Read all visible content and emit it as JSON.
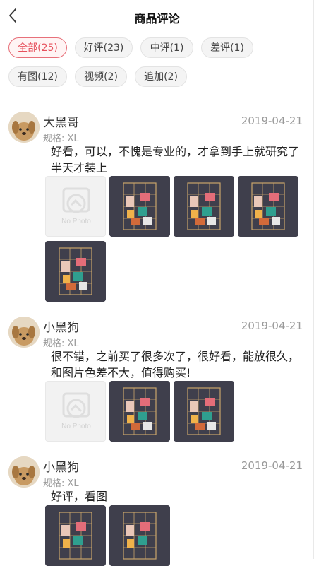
{
  "header": {
    "title": "商品评论"
  },
  "filters": [
    {
      "label": "全部(25)",
      "active": true
    },
    {
      "label": "好评(23)",
      "active": false
    },
    {
      "label": "中评(1)",
      "active": false
    },
    {
      "label": "差评(1)",
      "active": false
    },
    {
      "label": "有图(12)",
      "active": false
    },
    {
      "label": "视频(2)",
      "active": false
    },
    {
      "label": "追加(2)",
      "active": false
    }
  ],
  "reviews": [
    {
      "username": "大黑哥",
      "date": "2019-04-21",
      "spec": "规格: XL",
      "content": "好看，可以，不愧是专业的，才拿到手上就研究了半天才装上",
      "images": [
        "no-photo",
        "photo",
        "photo",
        "photo",
        "photo"
      ]
    },
    {
      "username": "小黑狗",
      "date": "2019-04-21",
      "spec": "规格: XL",
      "content": "很不错，之前买了很多次了，很好看，能放很久，和图片色差不大，值得购买!",
      "images": [
        "no-photo",
        "photo",
        "photo"
      ]
    },
    {
      "username": "小黑狗",
      "date": "2019-04-21",
      "spec": "规格: XL",
      "content": "好评，看图",
      "images": [
        "photo",
        "photo"
      ]
    }
  ],
  "placeholder_text": "No Photo",
  "colors": {
    "accent": "#e7515d",
    "chip_bg": "#f4f4f4",
    "muted": "#999999"
  }
}
